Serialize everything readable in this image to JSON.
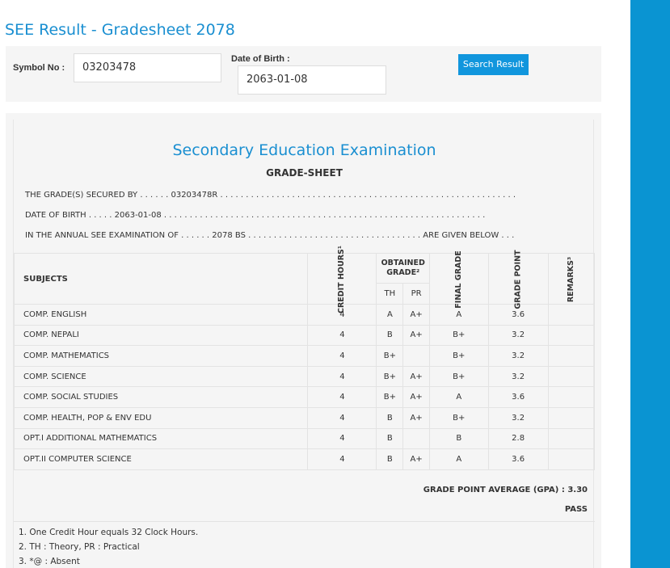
{
  "page": {
    "heading": "SEE Result - Gradesheet 2078"
  },
  "search": {
    "symbol_label": "Symbol No :",
    "symbol_value": "03203478",
    "dob_label": "Date of Birth :",
    "dob_value": "2063-01-08",
    "button_label": "Search Result"
  },
  "sheet": {
    "exam_title": "Secondary Education Examination",
    "sheet_title": "GRADE-SHEET",
    "line1": "THE GRADE(S) SECURED BY . . . . . . 03203478R . . . . . . . . . . . . . . . . . . . . . . . . . . . . . . . . . . . . . . . . . . . . . . . . . . . . . . . . . .",
    "line2": "DATE OF BIRTH . . . . . 2063-01-08 . . . . . . . . . . . . . . . . . . . . . . . . . . . . . . . . . . . . . . . . . . . . . . . . . . . . . . . . . . . . . . .",
    "line3": "IN THE ANNUAL SEE EXAMINATION OF . . . . . . 2078 BS . . . . . . . . . . . . . . . . . . . . . . . . . . . . . . . . . . ARE GIVEN BELOW . . .",
    "headers": {
      "subjects": "SUBJECTS",
      "credit_hours": "CREDIT HOURS¹",
      "obtained_grade": "OBTAINED GRADE²",
      "th": "TH",
      "pr": "PR",
      "final_grade": "FINAL GRADE",
      "grade_point": "GRADE POINT",
      "remarks": "REMARKS³"
    },
    "rows": [
      {
        "subject": "COMP. ENGLISH",
        "credit": "4",
        "th": "A",
        "pr": "A+",
        "final": "A",
        "gp": "3.6",
        "remarks": ""
      },
      {
        "subject": "COMP. NEPALI",
        "credit": "4",
        "th": "B",
        "pr": "A+",
        "final": "B+",
        "gp": "3.2",
        "remarks": ""
      },
      {
        "subject": "COMP. MATHEMATICS",
        "credit": "4",
        "th": "B+",
        "pr": "",
        "final": "B+",
        "gp": "3.2",
        "remarks": ""
      },
      {
        "subject": "COMP. SCIENCE",
        "credit": "4",
        "th": "B+",
        "pr": "A+",
        "final": "B+",
        "gp": "3.2",
        "remarks": ""
      },
      {
        "subject": "COMP. SOCIAL STUDIES",
        "credit": "4",
        "th": "B+",
        "pr": "A+",
        "final": "A",
        "gp": "3.6",
        "remarks": ""
      },
      {
        "subject": "COMP. HEALTH, POP & ENV EDU",
        "credit": "4",
        "th": "B",
        "pr": "A+",
        "final": "B+",
        "gp": "3.2",
        "remarks": ""
      },
      {
        "subject": "OPT.I ADDITIONAL MATHEMATICS",
        "credit": "4",
        "th": "B",
        "pr": "",
        "final": "B",
        "gp": "2.8",
        "remarks": ""
      },
      {
        "subject": "OPT.II COMPUTER SCIENCE",
        "credit": "4",
        "th": "B",
        "pr": "A+",
        "final": "A",
        "gp": "3.6",
        "remarks": ""
      }
    ],
    "gpa_text": "GRADE POINT AVERAGE (GPA) : 3.30",
    "result_text": "PASS",
    "footnotes": [
      "1. One Credit Hour equals 32 Clock Hours.",
      "2. TH : Theory, PR : Practical",
      "3. *@ : Absent"
    ]
  },
  "colors": {
    "accent": "#1a8fd1",
    "button": "#1196dd",
    "sidebar": "#0a94d2"
  }
}
